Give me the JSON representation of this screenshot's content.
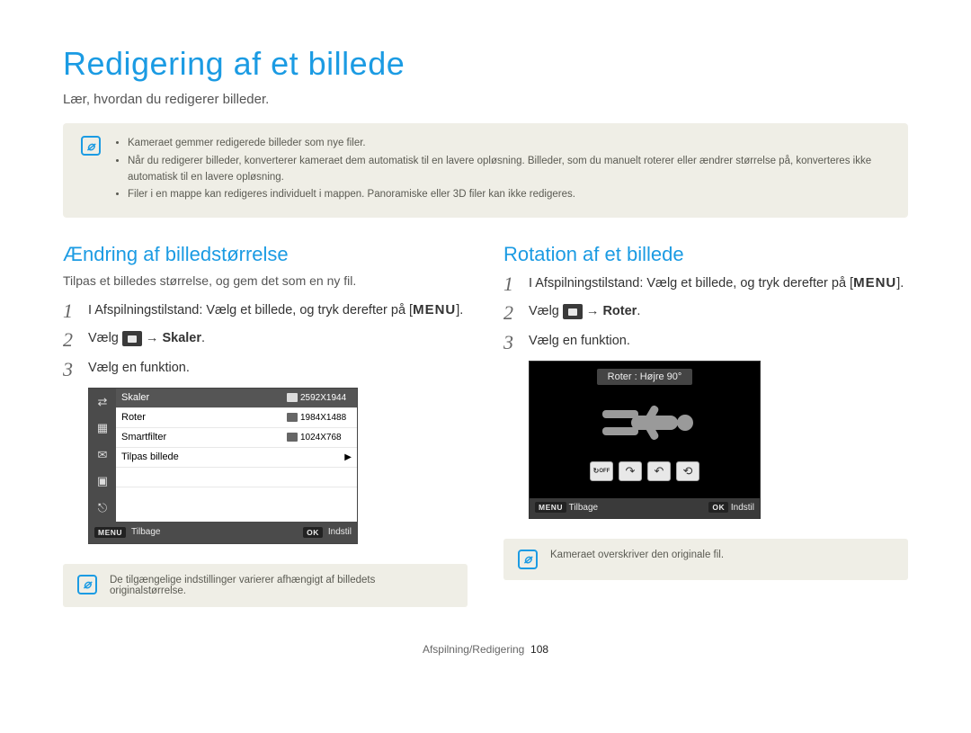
{
  "title": "Redigering af et billede",
  "intro": "Lær, hvordan du redigerer billeder.",
  "top_note": {
    "items": [
      "Kameraet gemmer redigerede billeder som nye filer.",
      "Når du redigerer billeder, konverterer kameraet dem automatisk til en lavere opløsning. Billeder, som du manuelt roterer eller ændrer størrelse på, konverteres ikke automatisk til en lavere opløsning.",
      "Filer i en mappe kan redigeres individuelt i mappen. Panoramiske eller 3D filer kan ikke redigeres."
    ]
  },
  "left": {
    "heading": "Ændring af billedstørrelse",
    "sub": "Tilpas et billedes størrelse, og gem det som en ny fil.",
    "step1_pre": "I Afspilningstilstand: Vælg et billede, og tryk derefter på [",
    "step1_menu": "MENU",
    "step1_post": "].",
    "step2_pre": "Vælg ",
    "step2_arrow": " → ",
    "step2_bold": "Skaler",
    "step2_post": ".",
    "step3": "Vælg en funktion.",
    "cam": {
      "rows": [
        {
          "label": "Skaler",
          "value": "2592X1944",
          "sel": true
        },
        {
          "label": "Roter",
          "value": "1984X1488",
          "sel": false
        },
        {
          "label": "Smartfilter",
          "value": "1024X768",
          "sel": false
        }
      ],
      "adjust": "Tilpas billede",
      "back_pill": "MENU",
      "back": "Tilbage",
      "ok_pill": "OK",
      "ok": "Indstil"
    },
    "note": "De tilgængelige indstillinger varierer afhængigt af billedets originalstørrelse."
  },
  "right": {
    "heading": "Rotation af et billede",
    "step1_pre": "I Afspilningstilstand: Vælg et billede, og tryk derefter på [",
    "step1_menu": "MENU",
    "step1_post": "].",
    "step2_pre": "Vælg ",
    "step2_arrow": " → ",
    "step2_bold": "Roter",
    "step2_post": ".",
    "step3": "Vælg en funktion.",
    "cam": {
      "label": "Roter : Højre 90°",
      "back_pill": "MENU",
      "back": "Tilbage",
      "ok_pill": "OK",
      "ok": "Indstil"
    },
    "note": "Kameraet overskriver den originale fil."
  },
  "footer": {
    "section": "Afspilning/Redigering",
    "page": "108"
  }
}
